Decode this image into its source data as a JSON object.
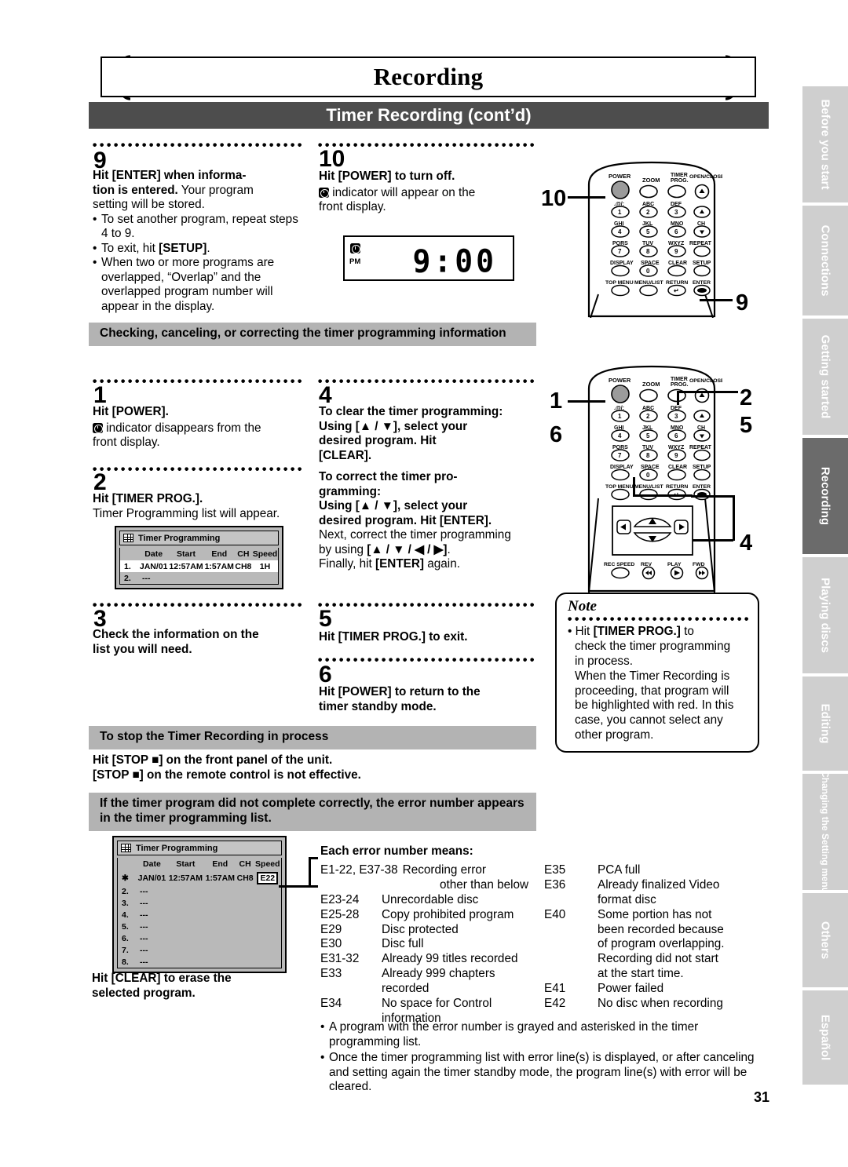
{
  "header": {
    "chapter_title": "Recording",
    "section_title": "Timer Recording (cont’d)"
  },
  "steps_top": [
    {
      "num": "9",
      "lines": [
        {
          "t": "Hit [ENTER] when informa-",
          "b": true
        },
        {
          "t": "tion is entered.",
          "b": true,
          "tail": " Your program"
        },
        {
          "t": "setting will be stored.",
          "b": false
        }
      ],
      "bullets": [
        "To set another program, repeat steps 4 to 9.",
        "To exit, hit [SETUP].",
        "When two or more programs are overlapped, “Overlap” and the overlapped program number will appear in the display."
      ]
    },
    {
      "num": "10",
      "heading": "Hit [POWER] to turn off.",
      "body_1": "indicator will appear on the",
      "body_2": "front display.",
      "display": {
        "pm": "PM",
        "time": "9:00"
      }
    }
  ],
  "grey_heading_1": "Checking, canceling, or correcting the timer programming information",
  "steps_mid": {
    "s1": {
      "num": "1",
      "heading": "Hit [POWER].",
      "body_1": "indicator disappears from the",
      "body_2": "front display."
    },
    "s2": {
      "num": "2",
      "heading": "Hit [TIMER PROG.].",
      "body": "Timer Programming list will appear."
    },
    "s3": {
      "num": "3",
      "heading_1": "Check the information on the",
      "heading_2": "list you will need."
    },
    "s4": {
      "num": "4",
      "p1_1": "To clear the timer programming:",
      "p1_2": "Using [▲ / ▼], select your",
      "p1_3": "desired program. Hit",
      "p1_4": "[CLEAR].",
      "p2_1": "To correct the timer pro-",
      "p2_2": "gramming:",
      "p2_3": "Using [▲ / ▼], select your",
      "p2_4": "desired program. Hit [ENTER].",
      "p3_1": "Next, correct the timer programming",
      "p3_2": "by using [▲ / ▼ / ◀ / ▶].",
      "p3_3": "Finally, hit [ENTER] again."
    },
    "s5": {
      "num": "5",
      "heading": "Hit [TIMER PROG.] to exit."
    },
    "s6": {
      "num": "6",
      "heading_1": "Hit [POWER] to return to the",
      "heading_2": "timer standby mode."
    }
  },
  "osd_list_1": {
    "title": "Timer Programming",
    "columns": [
      "",
      "Date",
      "Start",
      "End",
      "CH",
      "Speed"
    ],
    "rows": [
      {
        "num": "1.",
        "date": "JAN/01",
        "start": "12:57AM",
        "end": "1:57AM",
        "ch": "CH8",
        "speed": "1H",
        "highlight": true
      },
      {
        "num": "2.",
        "dash": "---"
      }
    ]
  },
  "grey_heading_2": "To stop the Timer Recording in process",
  "stop_text": {
    "line_1": "Hit [STOP ■] on the front panel of the unit.",
    "line_2": "[STOP ■] on the remote control is not effective."
  },
  "grey_heading_3": "If the timer program did not complete correctly, the error number appears in the timer programming list.",
  "osd_list_2": {
    "title": "Timer Programming",
    "columns": [
      "",
      "Date",
      "Start",
      "End",
      "CH",
      "Speed"
    ],
    "rows": [
      {
        "num": "✱",
        "date": "JAN/01",
        "start": "12:57AM",
        "end": "1:57AM",
        "ch": "CH8",
        "speed": "E22",
        "error": true
      },
      {
        "num": "2.",
        "dash": "---"
      },
      {
        "num": "3.",
        "dash": "---"
      },
      {
        "num": "4.",
        "dash": "---"
      },
      {
        "num": "5.",
        "dash": "---"
      },
      {
        "num": "6.",
        "dash": "---"
      },
      {
        "num": "7.",
        "dash": "---"
      },
      {
        "num": "8.",
        "dash": "---"
      }
    ]
  },
  "clear_note": {
    "line_1": "Hit [CLEAR] to erase the",
    "line_2": "selected program."
  },
  "errors": {
    "heading": "Each error number means:",
    "left": [
      {
        "code": "E1-22, E37-38",
        "desc": [
          "Recording error",
          "     other than below"
        ],
        "wide": true
      },
      {
        "code": "E23-24",
        "desc": [
          "Unrecordable disc"
        ]
      },
      {
        "code": "E25-28",
        "desc": [
          "Copy prohibited program"
        ]
      },
      {
        "code": "E29",
        "desc": [
          "Disc protected"
        ]
      },
      {
        "code": "E30",
        "desc": [
          "Disc full"
        ]
      },
      {
        "code": "E31-32",
        "desc": [
          "Already 99 titles recorded"
        ]
      },
      {
        "code": "E33",
        "desc": [
          "Already 999 chapters",
          "recorded"
        ]
      },
      {
        "code": "E34",
        "desc": [
          "No space for Control",
          "information"
        ]
      }
    ],
    "right": [
      {
        "code": "E35",
        "desc": [
          "PCA full"
        ]
      },
      {
        "code": "E36",
        "desc": [
          "Already finalized Video",
          "format disc"
        ]
      },
      {
        "code": "E40",
        "desc": [
          "Some portion has not",
          "been recorded because",
          "of program overlapping.",
          "Recording did not start",
          "at the start time."
        ]
      },
      {
        "code": "E41",
        "desc": [
          "Power failed"
        ]
      },
      {
        "code": "E42",
        "desc": [
          "No disc when recording"
        ]
      }
    ],
    "bullets": [
      "A program with the error number is grayed and asterisked in the timer programming list.",
      "Once the timer programming list with error line(s) is displayed, or after canceling and setting again the timer standby mode, the program line(s) with error will be cleared."
    ]
  },
  "note": {
    "label": "Note",
    "lines": [
      "• Hit [TIMER PROG.] to",
      "check the timer programming",
      "in process.",
      "When the Timer Recording is",
      "proceeding, that program will",
      "be highlighted with red. In this",
      "case, you cannot select any",
      "other program."
    ]
  },
  "remote": {
    "labels_top": [
      "POWER",
      "ZOOM",
      "TIMER PROG.",
      "OPEN/CLOSE"
    ],
    "keys": [
      {
        "lbl": ".@/:",
        "key": "1"
      },
      {
        "lbl": "ABC",
        "key": "2"
      },
      {
        "lbl": "DEF",
        "key": "3"
      },
      {
        "lbl": "",
        "key": "▲"
      },
      {
        "lbl": "GHI",
        "key": "4"
      },
      {
        "lbl": "JKL",
        "key": "5"
      },
      {
        "lbl": "MNO",
        "key": "6"
      },
      {
        "lbl": "CH",
        "key": "▼"
      },
      {
        "lbl": "PQRS",
        "key": "7"
      },
      {
        "lbl": "TUV",
        "key": "8"
      },
      {
        "lbl": "WXYZ",
        "key": "9"
      },
      {
        "lbl": "REPEAT",
        "key": ""
      },
      {
        "lbl": "DISPLAY",
        "key": ""
      },
      {
        "lbl": "SPACE",
        "key": "0"
      },
      {
        "lbl": "CLEAR",
        "key": ""
      },
      {
        "lbl": "SETUP",
        "key": ""
      },
      {
        "lbl": "TOP MENU",
        "key": ""
      },
      {
        "lbl": "MENU/LIST",
        "key": ""
      },
      {
        "lbl": "RETURN",
        "key": "↵"
      },
      {
        "lbl": "ENTER",
        "key": ""
      }
    ],
    "transport": [
      "REC SPEED",
      "REV",
      "PLAY",
      "FWD"
    ],
    "callouts_remote1": [
      "10",
      "9"
    ],
    "callouts_remote2": [
      "1",
      "6",
      "2",
      "5",
      "4"
    ]
  },
  "side_tabs": [
    {
      "label": "Before you start",
      "active": false
    },
    {
      "label": "Connections",
      "active": false
    },
    {
      "label": "Getting started",
      "active": false
    },
    {
      "label": "Recording",
      "active": true
    },
    {
      "label": "Playing discs",
      "active": false
    },
    {
      "label": "Editing",
      "active": false
    },
    {
      "label": "Changing the Setting menu",
      "active": false,
      "small": true
    },
    {
      "label": "Others",
      "active": false
    },
    {
      "label": "Español",
      "active": false
    }
  ],
  "page_number": "31"
}
